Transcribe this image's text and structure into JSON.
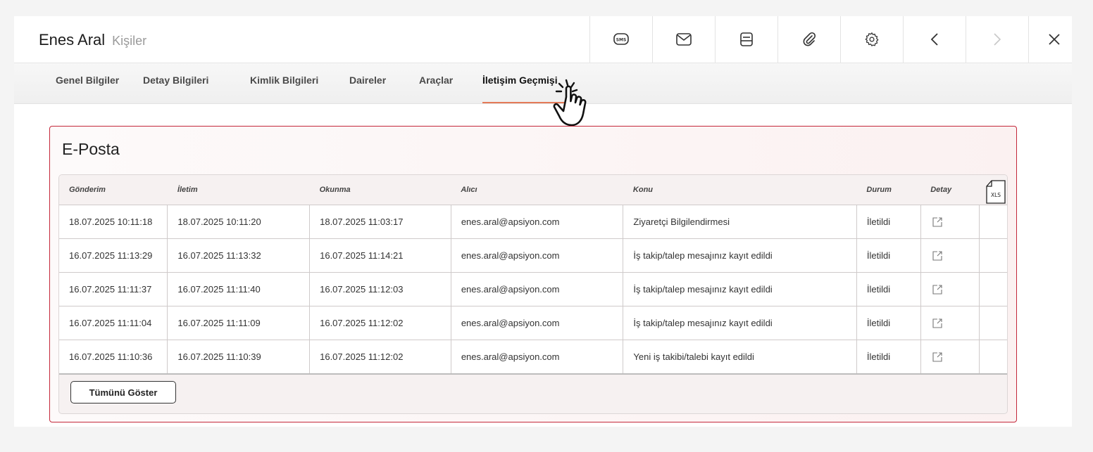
{
  "header": {
    "title": "Enes Aral",
    "subtitle": "Kişiler"
  },
  "toolbar": {
    "buttons": [
      {
        "icon": "sms-icon"
      },
      {
        "icon": "mail-icon"
      },
      {
        "icon": "print-icon"
      },
      {
        "icon": "attachment-icon"
      },
      {
        "icon": "gear-icon"
      },
      {
        "icon": "chevron-left-icon"
      },
      {
        "icon": "chevron-right-icon",
        "disabled": true
      },
      {
        "icon": "close-icon"
      }
    ],
    "sms_label": "SMS"
  },
  "tabs": [
    {
      "label": "Genel Bilgiler"
    },
    {
      "label": "Detay Bilgileri"
    },
    {
      "label": "Kimlik Bilgileri"
    },
    {
      "label": "Daireler"
    },
    {
      "label": "Araçlar"
    },
    {
      "label": "İletişim Geçmişi",
      "active": true
    }
  ],
  "email_panel": {
    "title": "E-Posta",
    "columns": [
      "Gönderim",
      "İletim",
      "Okunma",
      "Alıcı",
      "Konu",
      "Durum",
      "Detay"
    ],
    "export_label": "XLS",
    "rows": [
      {
        "gonderim": "18.07.2025 10:11:18",
        "iletim": "18.07.2025 10:11:20",
        "okunma": "18.07.2025 11:03:17",
        "alici": "enes.aral@apsiyon.com",
        "konu": "Ziyaretçi Bilgilendirmesi",
        "durum": "İletildi"
      },
      {
        "gonderim": "16.07.2025 11:13:29",
        "iletim": "16.07.2025 11:13:32",
        "okunma": "16.07.2025 11:14:21",
        "alici": "enes.aral@apsiyon.com",
        "konu": "İş takip/talep mesajınız kayıt edildi",
        "durum": "İletildi"
      },
      {
        "gonderim": "16.07.2025 11:11:37",
        "iletim": "16.07.2025 11:11:40",
        "okunma": "16.07.2025 11:12:03",
        "alici": "enes.aral@apsiyon.com",
        "konu": "İş takip/talep mesajınız kayıt edildi",
        "durum": "İletildi"
      },
      {
        "gonderim": "16.07.2025 11:11:04",
        "iletim": "16.07.2025 11:11:09",
        "okunma": "16.07.2025 11:12:02",
        "alici": "enes.aral@apsiyon.com",
        "konu": "İş takip/talep mesajınız kayıt edildi",
        "durum": "İletildi"
      },
      {
        "gonderim": "16.07.2025 11:10:36",
        "iletim": "16.07.2025 11:10:39",
        "okunma": "16.07.2025 11:12:02",
        "alici": "enes.aral@apsiyon.com",
        "konu": "Yeni iş takibi/talebi kayıt edildi",
        "durum": "İletildi"
      }
    ],
    "show_all_label": "Tümünü Göster"
  },
  "colors": {
    "accent": "#e47a57",
    "panel_border": "#c4273a"
  }
}
